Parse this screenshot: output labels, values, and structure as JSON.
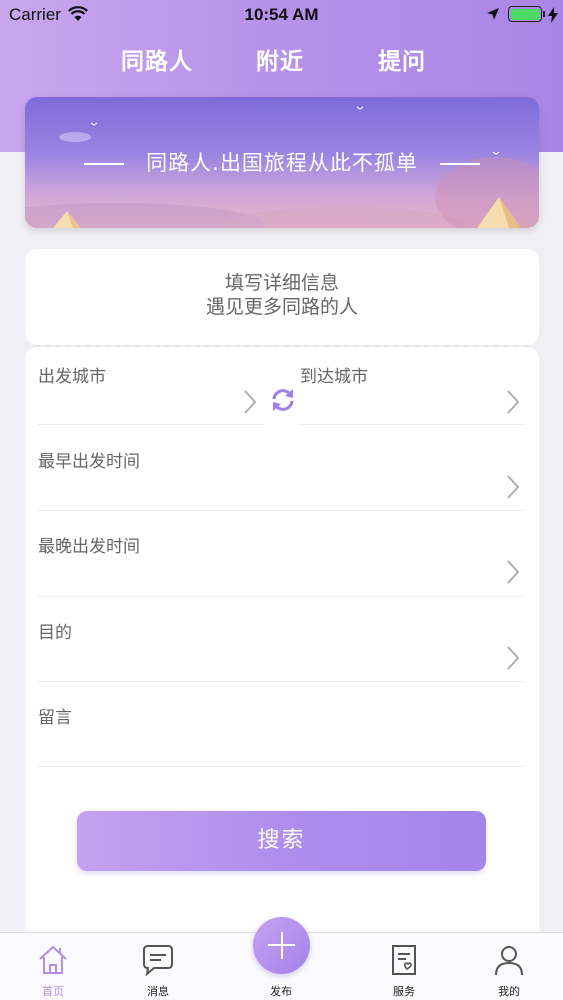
{
  "status_bar": {
    "carrier": "Carrier",
    "time": "10:54 AM",
    "battery_level": 1.0
  },
  "top_tabs": [
    {
      "label": "同路人"
    },
    {
      "label": "附近"
    },
    {
      "label": "提问"
    }
  ],
  "banner": {
    "text": "同路人.出国旅程从此不孤单"
  },
  "info_card": {
    "line1": "填写详细信息",
    "line2": "遇见更多同路的人"
  },
  "form": {
    "departure_city_label": "出发城市",
    "arrival_city_label": "到达城市",
    "earliest_departure_label": "最早出发时间",
    "latest_departure_label": "最晚出发时间",
    "purpose_label": "目的",
    "message_label": "留言",
    "search_label": "搜索"
  },
  "tabbar": {
    "items": [
      {
        "label": "首页",
        "icon": "home-icon",
        "active": true
      },
      {
        "label": "消息",
        "icon": "chat-bubble-icon",
        "active": false
      },
      {
        "label": "发布",
        "icon": "plus-icon",
        "active": false
      },
      {
        "label": "服务",
        "icon": "service-note-icon",
        "active": false
      },
      {
        "label": "我的",
        "icon": "person-icon",
        "active": false
      }
    ]
  },
  "colors": {
    "accent": "#b48be8",
    "header_gradient_start": "#c9a7ee",
    "header_gradient_end": "#a985e6"
  }
}
